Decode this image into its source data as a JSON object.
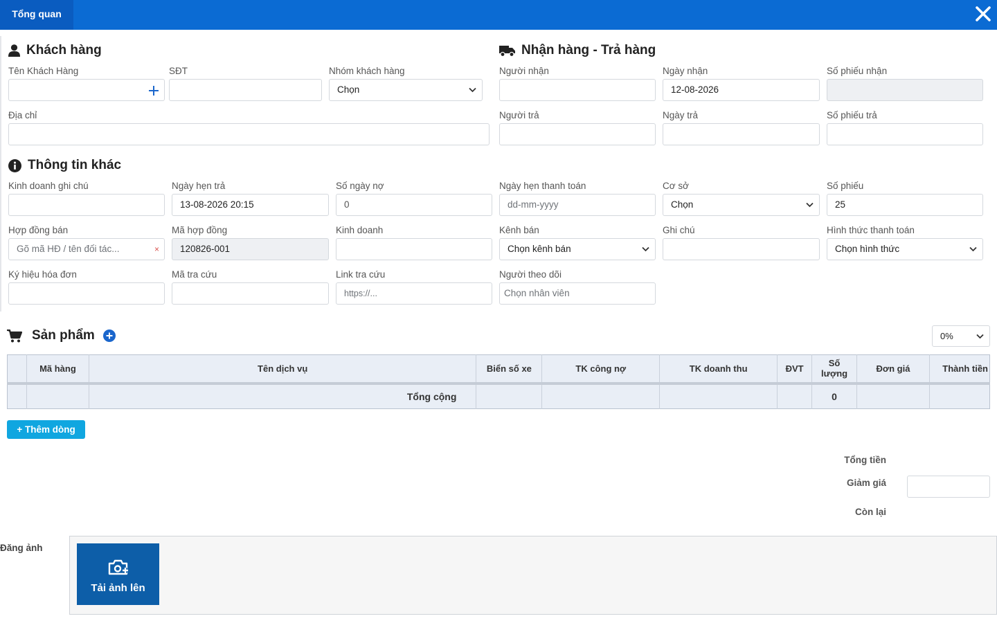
{
  "header": {
    "tab_label": "Tổng quan"
  },
  "customer": {
    "title": "Khách hàng",
    "name_label": "Tên Khách Hàng",
    "name_value": "",
    "phone_label": "SĐT",
    "phone_value": "",
    "group_label": "Nhóm khách hàng",
    "group_value": "Chọn",
    "address_label": "Địa chỉ",
    "address_value": ""
  },
  "delivery": {
    "title": "Nhận hàng - Trả hàng",
    "receiver_label": "Người nhận",
    "receiver_value": "",
    "receive_date_label": "Ngày nhận",
    "receive_date_value": "12-08-2026",
    "receive_no_label": "Số phiếu nhận",
    "receive_no_value": "",
    "returner_label": "Người trả",
    "returner_value": "",
    "return_date_label": "Ngày trả",
    "return_date_value": "",
    "return_no_label": "Số phiếu trả",
    "return_no_value": ""
  },
  "other": {
    "title": "Thông tin khác",
    "sales_note_label": "Kinh doanh ghi chú",
    "sales_note_value": "",
    "due_date_label": "Ngày hẹn trả",
    "due_date_value": "13-08-2026 20:15",
    "debt_days_label": "Số ngày nợ",
    "debt_days_value": "0",
    "pay_date_label": "Ngày hẹn thanh toán",
    "pay_date_placeholder": "dd-mm-yyyy",
    "branch_label": "Cơ sở",
    "branch_value": "Chọn",
    "ticket_no_label": "Số phiếu",
    "ticket_no_value": "25",
    "contract_label": "Hợp đồng bán",
    "contract_placeholder": "Gõ mã HĐ / tên đối tác...",
    "contract_clear": "×",
    "contract_code_label": "Mã hợp đồng",
    "contract_code_value": "120826-001",
    "sales_label": "Kinh doanh",
    "sales_value": "",
    "channel_label": "Kênh bán",
    "channel_value": "Chọn kênh bán",
    "note_label": "Ghi chú",
    "note_value": "",
    "payment_label": "Hình thức thanh toán",
    "payment_value": "Chọn hình thức",
    "invoice_sign_label": "Ký hiệu hóa đơn",
    "invoice_sign_value": "",
    "lookup_code_label": "Mã tra cứu",
    "lookup_code_value": "",
    "lookup_link_label": "Link tra cứu",
    "lookup_link_placeholder": "https://...",
    "follower_label": "Người theo dõi",
    "follower_placeholder": "Chọn nhân viên"
  },
  "products": {
    "title": "Sản phẩm",
    "vat_value": "0%",
    "columns": [
      "",
      "Mã hàng",
      "Tên dịch vụ",
      "Biển số xe",
      "TK công nợ",
      "TK doanh thu",
      "ĐVT",
      "Số lượng",
      "Đơn giá",
      "Thành tiền"
    ],
    "total_label": "Tổng cộng",
    "total_qty": "0",
    "add_row_label": "+ Thêm dòng"
  },
  "totals": {
    "total_label": "Tổng tiền",
    "discount_label": "Giảm giá",
    "discount_value": "",
    "remaining_label": "Còn lại"
  },
  "upload": {
    "label": "Đăng ảnh",
    "button_label": "Tải ảnh lên"
  },
  "colors": {
    "header_bg": "#0b6bd3",
    "tab_bg": "#0a5cc0",
    "add_btn": "#10a6e0",
    "upload_btn": "#0d5ea8",
    "accent": "#1a66cc"
  }
}
